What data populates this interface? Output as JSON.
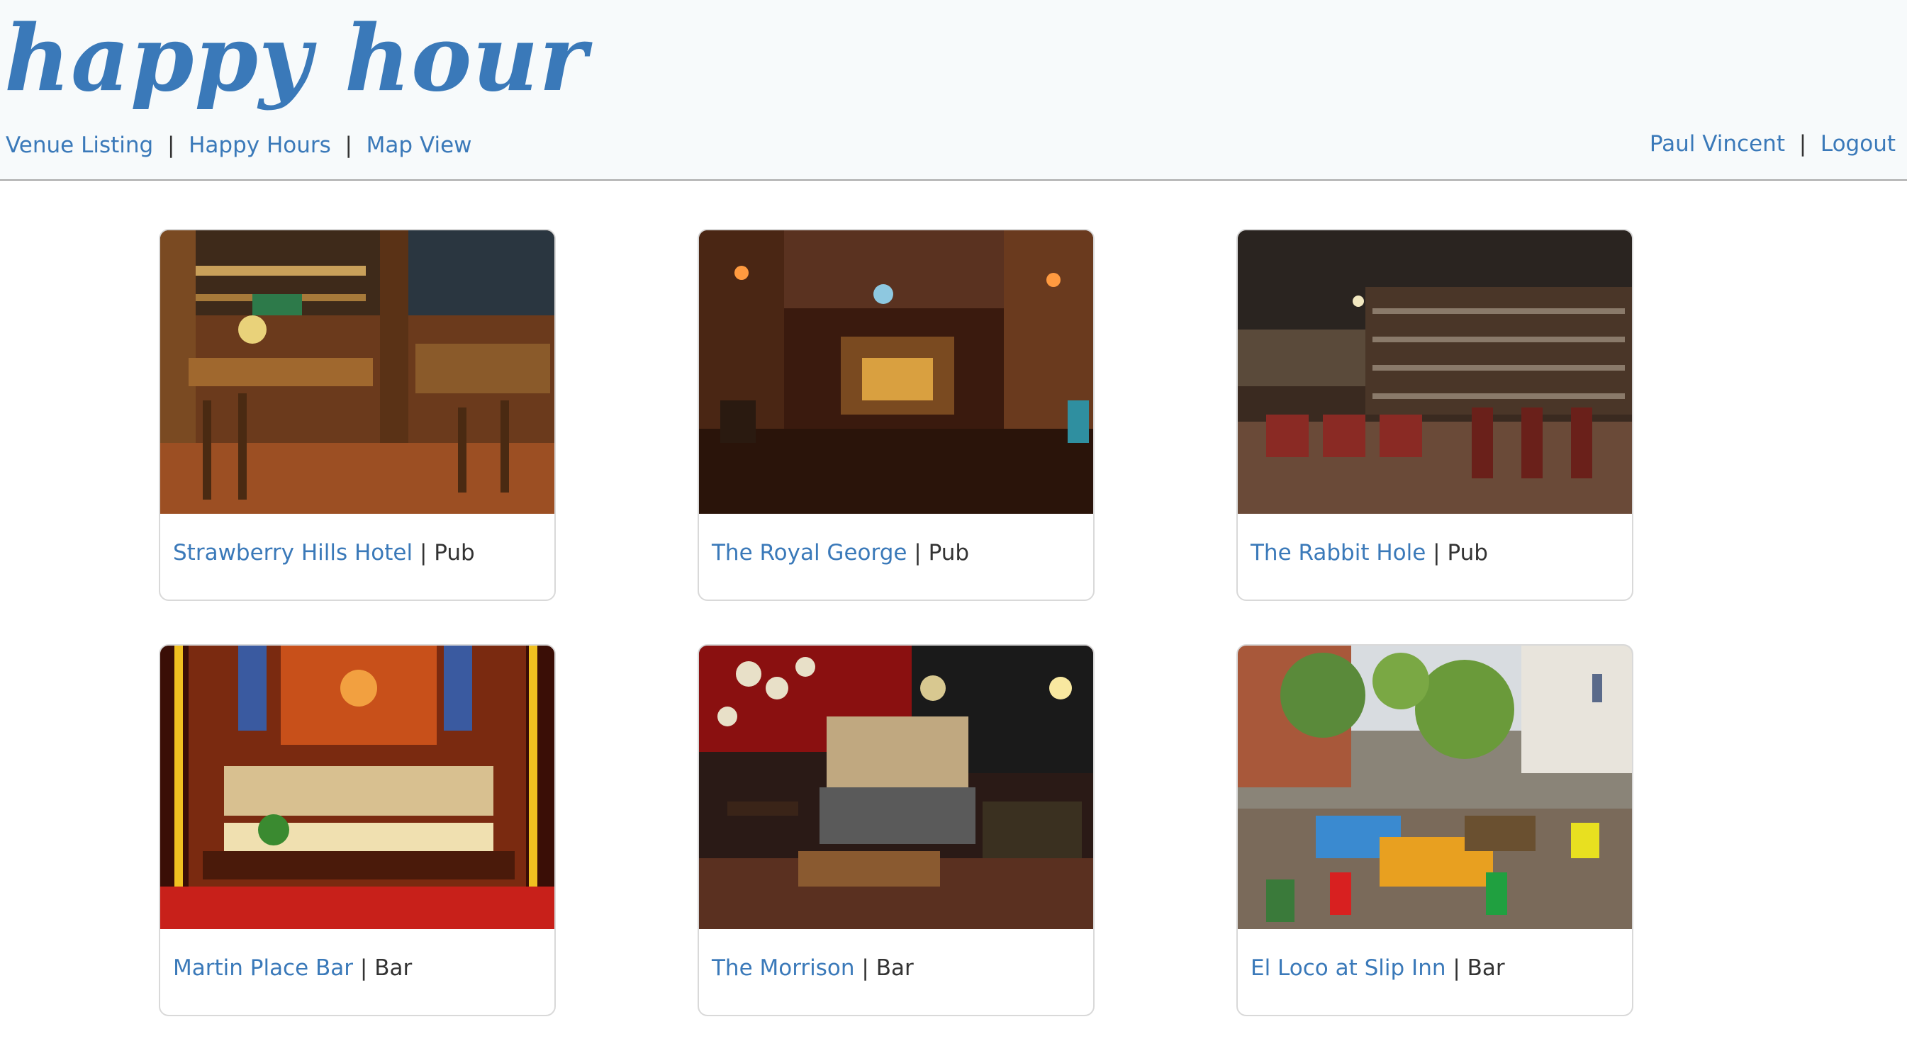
{
  "header": {
    "logo": "happy hour",
    "nav": {
      "venue_listing": "Venue Listing",
      "happy_hours": "Happy Hours",
      "map_view": "Map View",
      "separator": "|"
    },
    "user": {
      "name": "Paul Vincent",
      "logout": "Logout",
      "separator": "|"
    }
  },
  "venues": [
    {
      "name": "Strawberry Hills Hotel",
      "type": "Pub",
      "separator": " | "
    },
    {
      "name": "The Royal George",
      "type": "Pub",
      "separator": " | "
    },
    {
      "name": "The Rabbit Hole",
      "type": "Pub",
      "separator": " | "
    },
    {
      "name": "Martin Place Bar",
      "type": "Bar",
      "separator": " | "
    },
    {
      "name": "The Morrison",
      "type": "Bar",
      "separator": " | "
    },
    {
      "name": "El Loco at Slip Inn",
      "type": "Bar",
      "separator": " | "
    }
  ],
  "colors": {
    "link": "#3a79b9",
    "header_bg": "#f7fafb",
    "text": "#333333"
  }
}
